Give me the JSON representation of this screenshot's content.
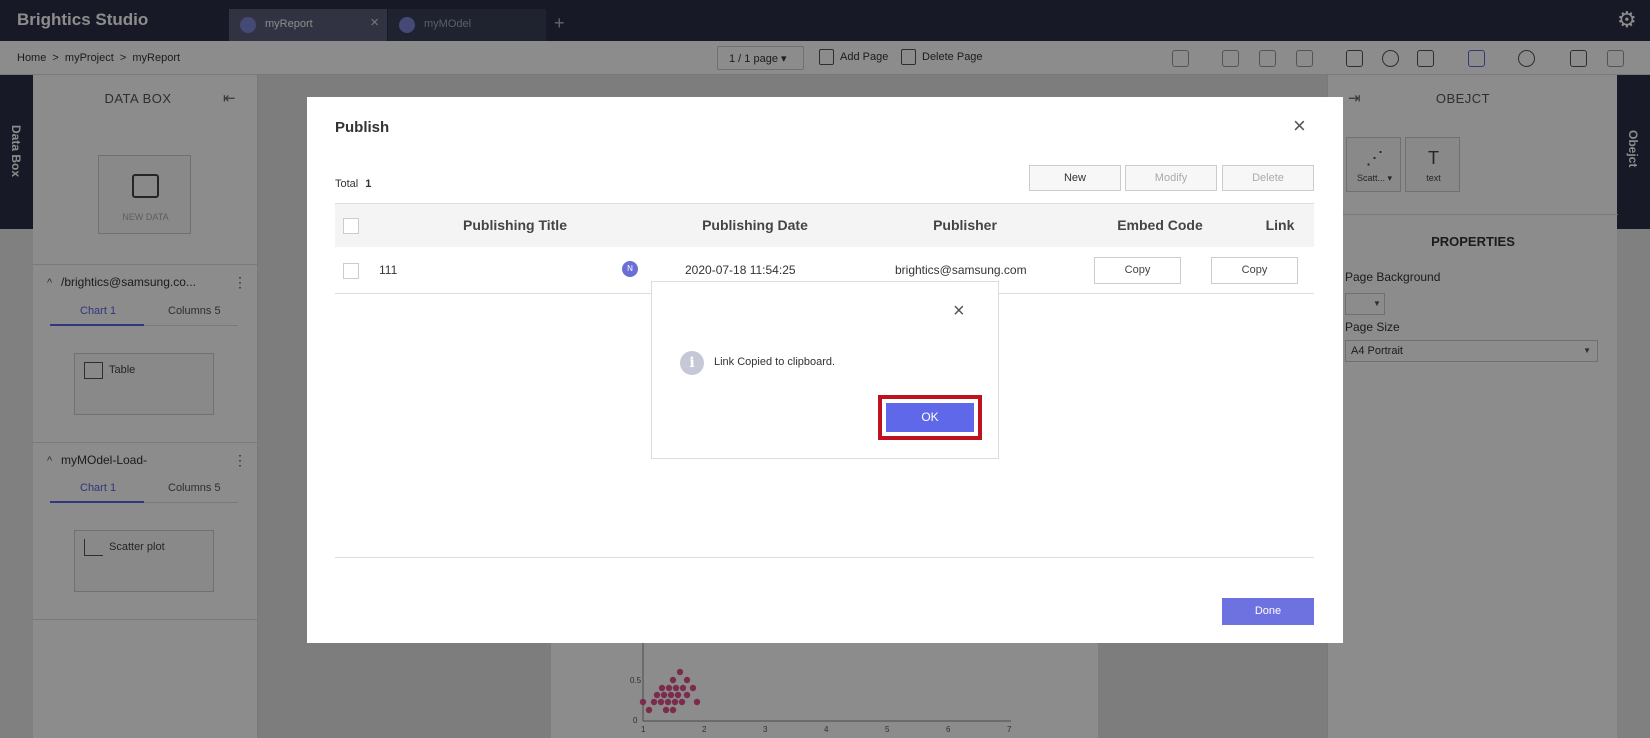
{
  "app": {
    "title": "Brightics Studio"
  },
  "tabs": [
    {
      "label": "myReport",
      "close": "×"
    },
    {
      "label": "myMOdel"
    }
  ],
  "add_tab": "+",
  "gear": "⚙",
  "breadcrumb": [
    "Home",
    ">",
    "myProject",
    ">",
    "myReport"
  ],
  "page_selector": "1 / 1 page ▾",
  "toolbar": {
    "add_page": "Add Page",
    "delete_page": "Delete Page"
  },
  "side_tabs": {
    "left": "Data Box",
    "right": "Obejct"
  },
  "data_box": {
    "title": "DATA BOX",
    "collapse": "⇤",
    "new_data": "NEW DATA",
    "sources": [
      {
        "name": "/brightics@samsung.co...",
        "tabs": [
          "Chart 1",
          "Columns 5"
        ],
        "card": "Table"
      },
      {
        "name": "myMOdel-Load-",
        "tabs": [
          "Chart 1",
          "Columns 5"
        ],
        "card": "Scatter plot"
      }
    ],
    "chev": "^",
    "kebab": "⋮"
  },
  "object_panel": {
    "title": "OBEJCT",
    "expand": "⇥",
    "objects": [
      {
        "label": "Scatt... ▾",
        "glyph": "⋰"
      },
      {
        "label": "text",
        "glyph": "T"
      }
    ],
    "properties_title": "PROPERTIES",
    "page_background_label": "Page Background",
    "page_size_label": "Page Size",
    "page_size_value": "A4 Portrait"
  },
  "mini_chart": {
    "y_ticks": [
      "0.5",
      "0"
    ],
    "x_ticks": [
      "1",
      "2",
      "3",
      "4",
      "5",
      "6",
      "7"
    ],
    "color": "#e0508a"
  },
  "publish": {
    "title": "Publish",
    "close": "×",
    "total_label": "Total",
    "total_value": "1",
    "buttons": {
      "new": "New",
      "modify": "Modify",
      "delete": "Delete"
    },
    "columns": [
      "Publishing Title",
      "Publishing Date",
      "Publisher",
      "Embed Code",
      "Link"
    ],
    "rows": [
      {
        "title": "111",
        "badge": "N",
        "date": "2020-07-18 11:54:25",
        "publisher": "brightics@samsung.com",
        "embed": "Copy",
        "link": "Copy"
      }
    ],
    "done": "Done"
  },
  "alert": {
    "close": "×",
    "icon": "i",
    "message": "Link Copied to clipboard.",
    "ok": "OK"
  },
  "colors": {
    "topbar": "#2b2f45",
    "accent": "#6068ea",
    "highlight": "#c0121e"
  }
}
